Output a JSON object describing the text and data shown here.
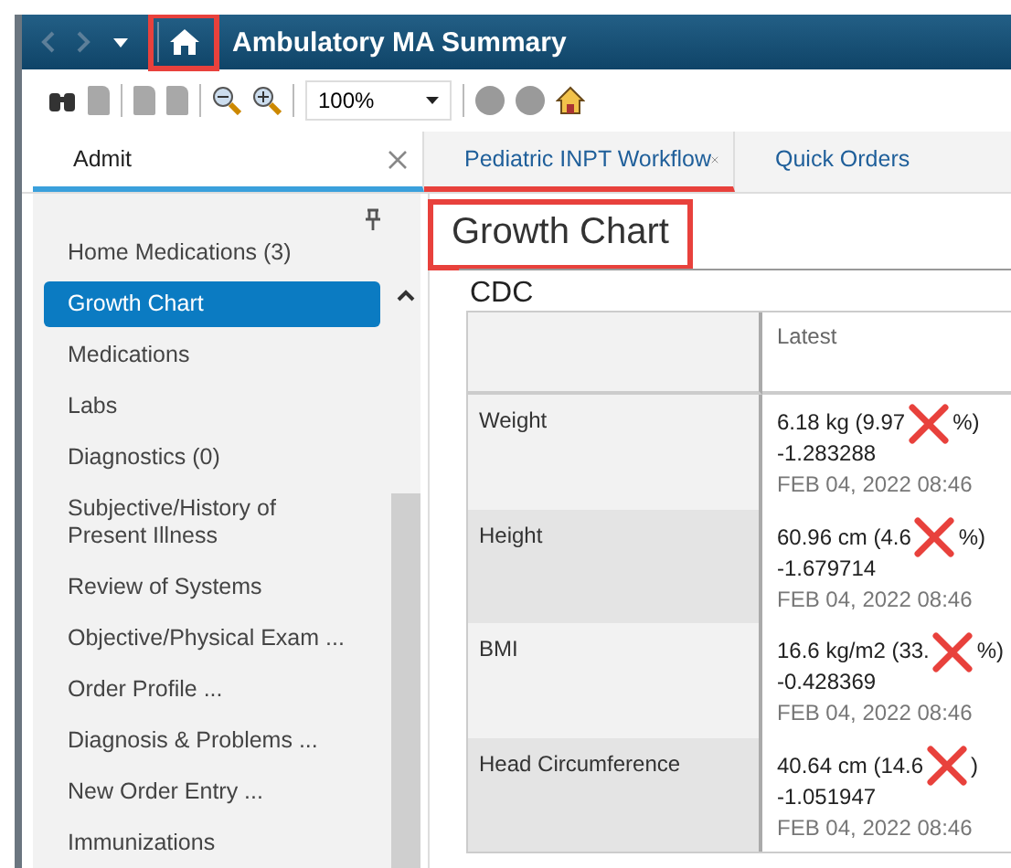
{
  "window": {
    "title": "Ambulatory MA Summary",
    "home_highlighted": true
  },
  "toolbar": {
    "zoom": "100%"
  },
  "tabs": [
    {
      "label": "Admit",
      "selected": true,
      "closable": true,
      "highlighted": false
    },
    {
      "label": "Pediatric INPT Workflow",
      "selected": false,
      "closable": true,
      "highlighted": true
    },
    {
      "label": "Quick Orders",
      "selected": false,
      "closable": false,
      "highlighted": false
    }
  ],
  "sidebar": {
    "items": [
      {
        "label": "Home Medications (3)",
        "selected": false
      },
      {
        "label": "Growth Chart",
        "selected": true
      },
      {
        "label": "Medications",
        "selected": false
      },
      {
        "label": "Labs",
        "selected": false
      },
      {
        "label": "Diagnostics (0)",
        "selected": false
      },
      {
        "label": "Subjective/History of Present Illness",
        "selected": false
      },
      {
        "label": "Review of Systems",
        "selected": false
      },
      {
        "label": "Objective/Physical Exam ...",
        "selected": false
      },
      {
        "label": "Order Profile ...",
        "selected": false
      },
      {
        "label": "Diagnosis & Problems ...",
        "selected": false
      },
      {
        "label": "New Order Entry ...",
        "selected": false
      },
      {
        "label": "Immunizations",
        "selected": false
      }
    ]
  },
  "section": {
    "title": "Growth Chart",
    "highlighted": true,
    "subtitle": "CDC",
    "table": {
      "columns": [
        "Latest"
      ],
      "rows": [
        {
          "name": "Weight",
          "value": "6.18 kg (9.97",
          "value_end": "%)",
          "score": "-1.283288",
          "date": "FEB 04, 2022 08:46",
          "crossed": true
        },
        {
          "name": "Height",
          "value": "60.96 cm (4.6",
          "value_end": "%)",
          "score": "-1.679714",
          "date": "FEB 04, 2022 08:46",
          "crossed": true
        },
        {
          "name": "BMI",
          "value": "16.6 kg/m2 (33.",
          "value_end": "%)",
          "score": "-0.428369",
          "date": "FEB 04, 2022 08:46",
          "crossed": true
        },
        {
          "name": "Head Circumference",
          "value": "40.64 cm (14.6",
          "value_end": ")",
          "score": "-1.051947",
          "date": "FEB 04, 2022 08:46",
          "crossed": true
        }
      ]
    }
  }
}
